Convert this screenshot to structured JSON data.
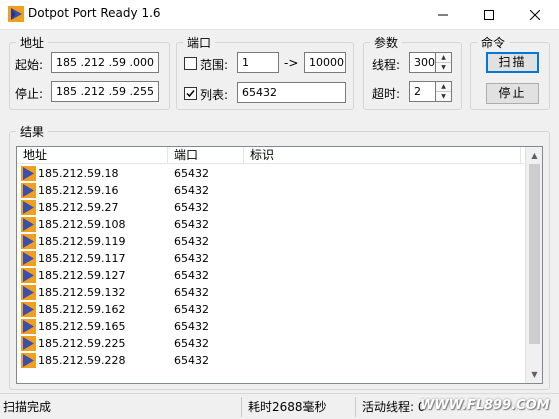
{
  "window": {
    "title": "Dotpot Port Ready 1.6",
    "controls": [
      "minimize",
      "maximize",
      "close"
    ]
  },
  "address_group": {
    "legend": "地址",
    "start_label": "起始:",
    "start_ip": [
      "185",
      ".212",
      ".59",
      ".000"
    ],
    "end_label": "停止:",
    "end_ip": [
      "185",
      ".212",
      ".59",
      ".255"
    ]
  },
  "port_group": {
    "legend": "端口",
    "range_label": "范围:",
    "range_checked": false,
    "range_from": "1",
    "range_arrow": "->",
    "range_to": "10000",
    "list_label": "列表:",
    "list_checked": true,
    "list_value": "65432"
  },
  "params_group": {
    "legend": "参数",
    "threads_label": "线程:",
    "threads_value": "300",
    "timeout_label": "超时:",
    "timeout_value": "2"
  },
  "command_group": {
    "legend": "命令",
    "scan_button": "扫描",
    "stop_button": "停止"
  },
  "results": {
    "legend": "结果",
    "columns": [
      "地址",
      "端口",
      "标识"
    ],
    "rows": [
      {
        "address": "185.212.59.18",
        "port": "65432",
        "banner": ""
      },
      {
        "address": "185.212.59.16",
        "port": "65432",
        "banner": ""
      },
      {
        "address": "185.212.59.27",
        "port": "65432",
        "banner": ""
      },
      {
        "address": "185.212.59.108",
        "port": "65432",
        "banner": ""
      },
      {
        "address": "185.212.59.119",
        "port": "65432",
        "banner": ""
      },
      {
        "address": "185.212.59.117",
        "port": "65432",
        "banner": ""
      },
      {
        "address": "185.212.59.127",
        "port": "65432",
        "banner": ""
      },
      {
        "address": "185.212.59.132",
        "port": "65432",
        "banner": ""
      },
      {
        "address": "185.212.59.162",
        "port": "65432",
        "banner": ""
      },
      {
        "address": "185.212.59.165",
        "port": "65432",
        "banner": ""
      },
      {
        "address": "185.212.59.225",
        "port": "65432",
        "banner": ""
      },
      {
        "address": "185.212.59.228",
        "port": "65432",
        "banner": ""
      }
    ]
  },
  "statusbar": {
    "status": "扫描完成",
    "elapsed": "耗时2688毫秒",
    "active_threads": "活动线程: 0"
  },
  "watermark": "WWW.FL899.COM",
  "colors": {
    "accent": "#0078d7",
    "icon_orange": "#f0a020",
    "icon_blue": "#3a4fb0"
  }
}
